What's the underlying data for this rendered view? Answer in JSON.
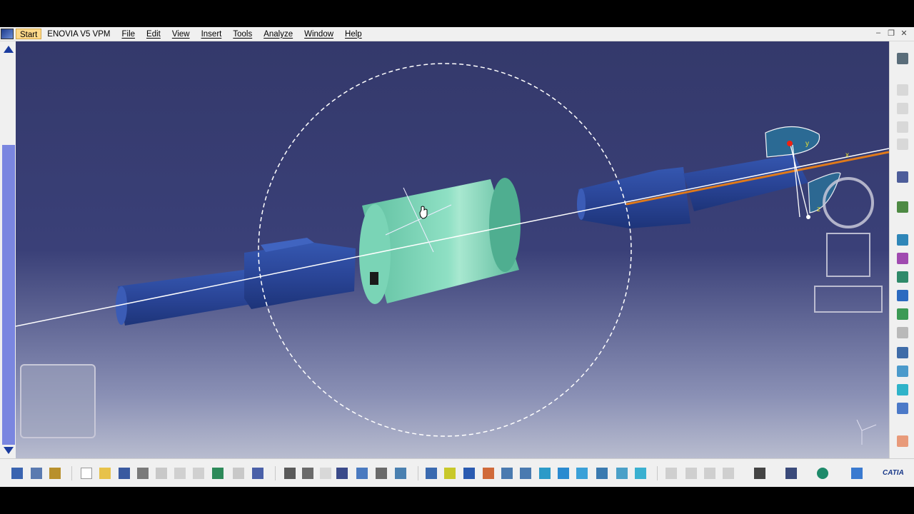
{
  "menubar": {
    "start_label": "Start",
    "items": [
      "ENOVIA V5 VPM",
      "File",
      "Edit",
      "View",
      "Insert",
      "Tools",
      "Analyze",
      "Window",
      "Help"
    ]
  },
  "window_controls": {
    "minimize": "–",
    "restore": "❐",
    "close": "✕"
  },
  "axis_labels": {
    "y": "y",
    "x": "x",
    "z": "z"
  },
  "brand": "CATIA",
  "colors": {
    "viewport_top": "#34396b",
    "part_blue": "#2c4a9c",
    "coupling_green": "#6fcfb1",
    "axis_orange": "#e07a1a",
    "selection_white": "#ffffff",
    "scrollbar": "#7a86e0"
  },
  "right_toolbar_icons": [
    "compass-icon",
    "part-icon",
    "part-icon",
    "part-icon",
    "part-icon",
    "select-arrow-icon",
    "gear-icon",
    "move-icon",
    "snap-icon",
    "explode-icon",
    "manipulate-icon",
    "constraint-icon",
    "measure-icon",
    "clash-icon",
    "section-icon",
    "sweep-icon",
    "analysis-icon",
    "catalog-icon"
  ],
  "bottom_toolbar_icons": [
    "update-icon",
    "catalog-icon",
    "lock-icon",
    "new-icon",
    "open-icon",
    "save-icon",
    "print-icon",
    "cut-icon",
    "copy-icon",
    "paste-icon",
    "undo-icon",
    "redo-icon",
    "help-icon",
    "formula-icon",
    "knowledge-icon",
    "hide-icon",
    "table-icon",
    "tree-icon",
    "parts-icon",
    "chart-icon",
    "pan-all-icon",
    "fit-all-icon",
    "pan-icon",
    "rotate-icon",
    "zoom-in-icon",
    "zoom-out-icon",
    "normal-view-icon",
    "views-icon",
    "iso-icon",
    "shading-icon",
    "hide-show-icon",
    "swap-icon",
    "sketch-icon",
    "measure-icon",
    "arrow-icon",
    "camera-icon",
    "scene-icon",
    "compass-reset-icon",
    "layer-icon"
  ]
}
